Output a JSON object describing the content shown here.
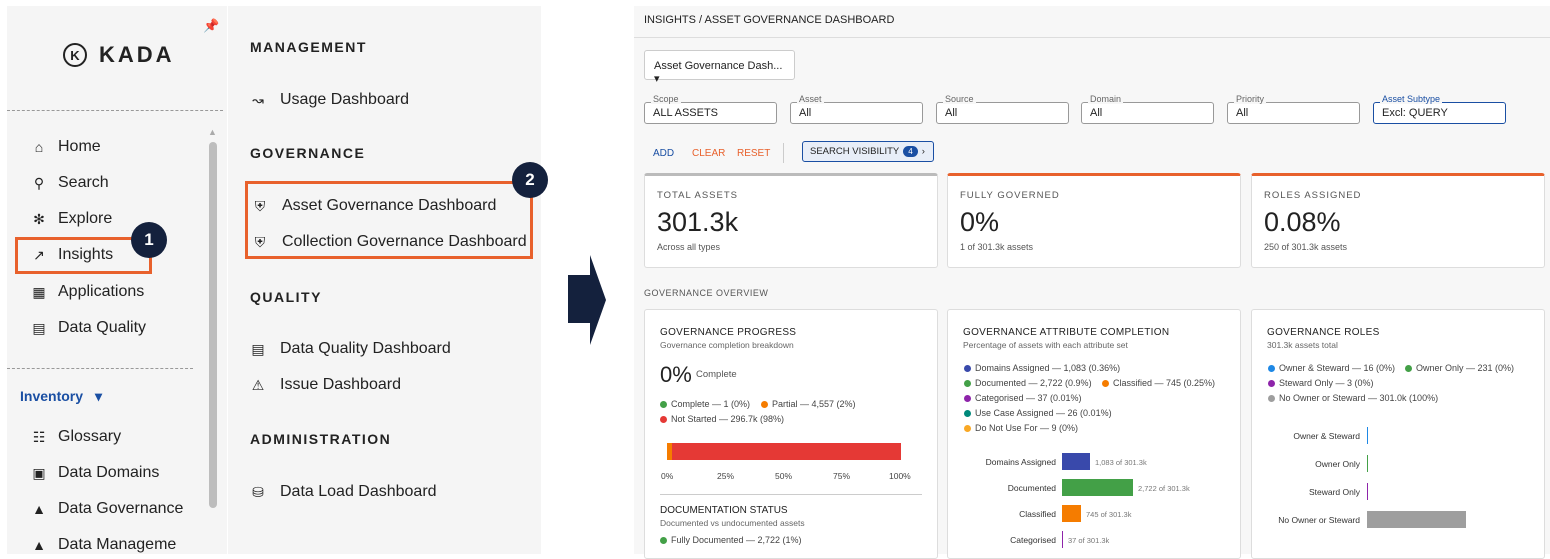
{
  "sidebar": {
    "brand": "KADA",
    "brand_mark": "K",
    "nav_items": [
      {
        "icon": "home-icon",
        "label": "Home"
      },
      {
        "icon": "search-icon",
        "label": "Search"
      },
      {
        "icon": "explore-icon",
        "label": "Explore"
      },
      {
        "icon": "insights-icon",
        "label": "Insights"
      },
      {
        "icon": "applications-icon",
        "label": "Applications"
      },
      {
        "icon": "data-quality-icon",
        "label": "Data Quality"
      }
    ],
    "inventory_label": "Inventory",
    "inventory_items": [
      {
        "icon": "glossary-icon",
        "label": "Glossary"
      },
      {
        "icon": "data-domains-icon",
        "label": "Data Domains"
      },
      {
        "icon": "data-governance-icon",
        "label": "Data Governance"
      },
      {
        "icon": "data-management-icon",
        "label": "Data Manageme"
      }
    ],
    "callout_number": "1"
  },
  "menu": {
    "sections": [
      {
        "title": "MANAGEMENT",
        "items": [
          {
            "icon": "usage-icon",
            "label": "Usage Dashboard"
          }
        ]
      },
      {
        "title": "GOVERNANCE",
        "items": [
          {
            "icon": "shield-icon",
            "label": "Asset Governance Dashboard"
          },
          {
            "icon": "shield-icon",
            "label": "Collection Governance Dashboard"
          }
        ]
      },
      {
        "title": "QUALITY",
        "items": [
          {
            "icon": "data-quality-icon",
            "label": "Data Quality Dashboard"
          },
          {
            "icon": "warning-icon",
            "label": "Issue Dashboard"
          }
        ]
      },
      {
        "title": "ADMINISTRATION",
        "items": [
          {
            "icon": "database-icon",
            "label": "Data Load Dashboard"
          }
        ]
      }
    ],
    "callout_number": "2"
  },
  "dashboard": {
    "breadcrumb": "INSIGHTS / ASSET GOVERNANCE DASHBOARD",
    "dashboard_select": "Asset Governance Dash...",
    "filters": [
      {
        "label": "Scope",
        "value": "ALL ASSETS"
      },
      {
        "label": "Asset",
        "value": "All"
      },
      {
        "label": "Source",
        "value": "All"
      },
      {
        "label": "Domain",
        "value": "All"
      },
      {
        "label": "Priority",
        "value": "All"
      },
      {
        "label": "Asset Subtype",
        "value": "Excl: QUERY"
      }
    ],
    "actions": {
      "add": "ADD",
      "clear": "CLEAR",
      "reset": "RESET",
      "search_visibility": "SEARCH VISIBILITY",
      "search_visibility_count": "4"
    },
    "kpis": [
      {
        "title": "TOTAL ASSETS",
        "value": "301.3k",
        "sub": "Across all types"
      },
      {
        "title": "FULLY GOVERNED",
        "value": "0%",
        "sub": "1 of 301.3k assets"
      },
      {
        "title": "ROLES ASSIGNED",
        "value": "0.08%",
        "sub": "250 of 301.3k assets"
      }
    ],
    "overview_title": "GOVERNANCE OVERVIEW",
    "progress": {
      "title": "GOVERNANCE PROGRESS",
      "subtitle": "Governance completion breakdown",
      "value": "0%",
      "value_label": "Complete",
      "legend": [
        {
          "label": "Complete — 1 (0%)",
          "color": "#43a047"
        },
        {
          "label": "Partial — 4,557 (2%)",
          "color": "#f57c00"
        },
        {
          "label": "Not Started — 296.7k (98%)",
          "color": "#e53935"
        }
      ],
      "ticks": [
        "0%",
        "25%",
        "50%",
        "75%",
        "100%"
      ],
      "doc_title": "DOCUMENTATION STATUS",
      "doc_subtitle": "Documented vs undocumented assets",
      "doc_legend": "Fully Documented — 2,722 (1%)"
    },
    "attributes": {
      "title": "GOVERNANCE ATTRIBUTE COMPLETION",
      "subtitle": "Percentage of assets with each attribute set",
      "legend": [
        {
          "label": "Domains Assigned — 1,083 (0.36%)",
          "color": "#3949ab"
        },
        {
          "label": "Documented — 2,722 (0.9%)",
          "color": "#43a047"
        },
        {
          "label": "Classified — 745 (0.25%)",
          "color": "#f57c00"
        },
        {
          "label": "Categorised — 37 (0.01%)",
          "color": "#8e24aa"
        },
        {
          "label": "Use Case Assigned — 26 (0.01%)",
          "color": "#00897b"
        },
        {
          "label": "Do Not Use For — 9 (0%)",
          "color": "#f9a825"
        }
      ],
      "bars": [
        {
          "label": "Domains Assigned",
          "text": "1,083 of 301.3k",
          "color": "#3949ab"
        },
        {
          "label": "Documented",
          "text": "2,722 of 301.3k",
          "color": "#43a047"
        },
        {
          "label": "Classified",
          "text": "745 of 301.3k",
          "color": "#f57c00"
        },
        {
          "label": "Categorised",
          "text": "37 of 301.3k",
          "color": "#8e24aa"
        }
      ]
    },
    "roles": {
      "title": "GOVERNANCE ROLES",
      "subtitle": "301.3k assets total",
      "legend": [
        {
          "label": "Owner & Steward — 16 (0%)",
          "color": "#1e88e5"
        },
        {
          "label": "Owner Only — 231 (0%)",
          "color": "#43a047"
        },
        {
          "label": "Steward Only — 3 (0%)",
          "color": "#8e24aa"
        },
        {
          "label": "No Owner or Steward — 301.0k (100%)",
          "color": "#9e9e9e"
        }
      ],
      "bars": [
        {
          "label": "Owner & Steward",
          "color": "#1e88e5"
        },
        {
          "label": "Owner Only",
          "color": "#43a047"
        },
        {
          "label": "Steward Only",
          "color": "#8e24aa"
        },
        {
          "label": "No Owner or Steward",
          "color": "#9e9e9e"
        }
      ]
    }
  },
  "chart_data": [
    {
      "type": "bar",
      "title": "GOVERNANCE PROGRESS",
      "categories": [
        "Complete",
        "Partial",
        "Not Started"
      ],
      "values": [
        0,
        2,
        98
      ],
      "ylim": [
        0,
        100
      ]
    },
    {
      "type": "bar",
      "title": "GOVERNANCE ATTRIBUTE COMPLETION",
      "categories": [
        "Domains Assigned",
        "Documented",
        "Classified",
        "Categorised"
      ],
      "values": [
        1083,
        2722,
        745,
        37
      ]
    },
    {
      "type": "bar",
      "title": "GOVERNANCE ROLES",
      "categories": [
        "Owner & Steward",
        "Owner Only",
        "Steward Only",
        "No Owner or Steward"
      ],
      "values": [
        16,
        231,
        3,
        301000
      ]
    }
  ]
}
